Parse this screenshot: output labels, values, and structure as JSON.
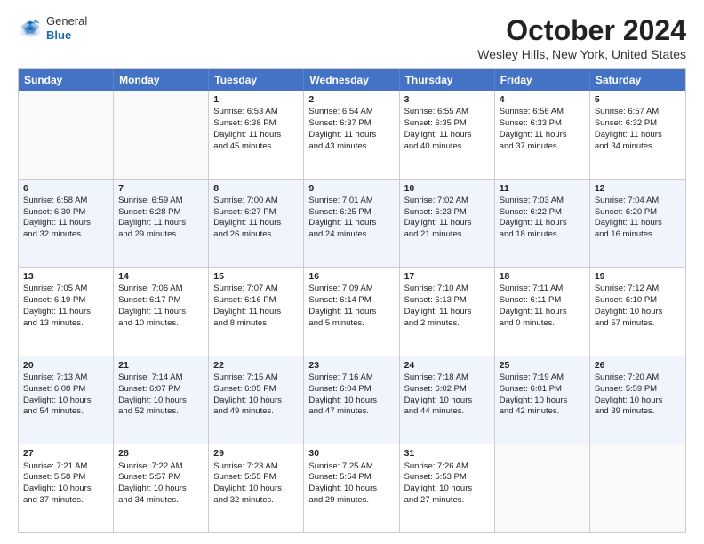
{
  "header": {
    "logo": {
      "general": "General",
      "blue": "Blue"
    },
    "title": "October 2024",
    "location": "Wesley Hills, New York, United States"
  },
  "days_of_week": [
    "Sunday",
    "Monday",
    "Tuesday",
    "Wednesday",
    "Thursday",
    "Friday",
    "Saturday"
  ],
  "weeks": [
    [
      {
        "day": "",
        "lines": [],
        "empty": true
      },
      {
        "day": "",
        "lines": [],
        "empty": true
      },
      {
        "day": "1",
        "lines": [
          "Sunrise: 6:53 AM",
          "Sunset: 6:38 PM",
          "Daylight: 11 hours",
          "and 45 minutes."
        ]
      },
      {
        "day": "2",
        "lines": [
          "Sunrise: 6:54 AM",
          "Sunset: 6:37 PM",
          "Daylight: 11 hours",
          "and 43 minutes."
        ]
      },
      {
        "day": "3",
        "lines": [
          "Sunrise: 6:55 AM",
          "Sunset: 6:35 PM",
          "Daylight: 11 hours",
          "and 40 minutes."
        ]
      },
      {
        "day": "4",
        "lines": [
          "Sunrise: 6:56 AM",
          "Sunset: 6:33 PM",
          "Daylight: 11 hours",
          "and 37 minutes."
        ]
      },
      {
        "day": "5",
        "lines": [
          "Sunrise: 6:57 AM",
          "Sunset: 6:32 PM",
          "Daylight: 11 hours",
          "and 34 minutes."
        ]
      }
    ],
    [
      {
        "day": "6",
        "lines": [
          "Sunrise: 6:58 AM",
          "Sunset: 6:30 PM",
          "Daylight: 11 hours",
          "and 32 minutes."
        ]
      },
      {
        "day": "7",
        "lines": [
          "Sunrise: 6:59 AM",
          "Sunset: 6:28 PM",
          "Daylight: 11 hours",
          "and 29 minutes."
        ]
      },
      {
        "day": "8",
        "lines": [
          "Sunrise: 7:00 AM",
          "Sunset: 6:27 PM",
          "Daylight: 11 hours",
          "and 26 minutes."
        ]
      },
      {
        "day": "9",
        "lines": [
          "Sunrise: 7:01 AM",
          "Sunset: 6:25 PM",
          "Daylight: 11 hours",
          "and 24 minutes."
        ]
      },
      {
        "day": "10",
        "lines": [
          "Sunrise: 7:02 AM",
          "Sunset: 6:23 PM",
          "Daylight: 11 hours",
          "and 21 minutes."
        ]
      },
      {
        "day": "11",
        "lines": [
          "Sunrise: 7:03 AM",
          "Sunset: 6:22 PM",
          "Daylight: 11 hours",
          "and 18 minutes."
        ]
      },
      {
        "day": "12",
        "lines": [
          "Sunrise: 7:04 AM",
          "Sunset: 6:20 PM",
          "Daylight: 11 hours",
          "and 16 minutes."
        ]
      }
    ],
    [
      {
        "day": "13",
        "lines": [
          "Sunrise: 7:05 AM",
          "Sunset: 6:19 PM",
          "Daylight: 11 hours",
          "and 13 minutes."
        ]
      },
      {
        "day": "14",
        "lines": [
          "Sunrise: 7:06 AM",
          "Sunset: 6:17 PM",
          "Daylight: 11 hours",
          "and 10 minutes."
        ]
      },
      {
        "day": "15",
        "lines": [
          "Sunrise: 7:07 AM",
          "Sunset: 6:16 PM",
          "Daylight: 11 hours",
          "and 8 minutes."
        ]
      },
      {
        "day": "16",
        "lines": [
          "Sunrise: 7:09 AM",
          "Sunset: 6:14 PM",
          "Daylight: 11 hours",
          "and 5 minutes."
        ]
      },
      {
        "day": "17",
        "lines": [
          "Sunrise: 7:10 AM",
          "Sunset: 6:13 PM",
          "Daylight: 11 hours",
          "and 2 minutes."
        ]
      },
      {
        "day": "18",
        "lines": [
          "Sunrise: 7:11 AM",
          "Sunset: 6:11 PM",
          "Daylight: 11 hours",
          "and 0 minutes."
        ]
      },
      {
        "day": "19",
        "lines": [
          "Sunrise: 7:12 AM",
          "Sunset: 6:10 PM",
          "Daylight: 10 hours",
          "and 57 minutes."
        ]
      }
    ],
    [
      {
        "day": "20",
        "lines": [
          "Sunrise: 7:13 AM",
          "Sunset: 6:08 PM",
          "Daylight: 10 hours",
          "and 54 minutes."
        ]
      },
      {
        "day": "21",
        "lines": [
          "Sunrise: 7:14 AM",
          "Sunset: 6:07 PM",
          "Daylight: 10 hours",
          "and 52 minutes."
        ]
      },
      {
        "day": "22",
        "lines": [
          "Sunrise: 7:15 AM",
          "Sunset: 6:05 PM",
          "Daylight: 10 hours",
          "and 49 minutes."
        ]
      },
      {
        "day": "23",
        "lines": [
          "Sunrise: 7:16 AM",
          "Sunset: 6:04 PM",
          "Daylight: 10 hours",
          "and 47 minutes."
        ]
      },
      {
        "day": "24",
        "lines": [
          "Sunrise: 7:18 AM",
          "Sunset: 6:02 PM",
          "Daylight: 10 hours",
          "and 44 minutes."
        ]
      },
      {
        "day": "25",
        "lines": [
          "Sunrise: 7:19 AM",
          "Sunset: 6:01 PM",
          "Daylight: 10 hours",
          "and 42 minutes."
        ]
      },
      {
        "day": "26",
        "lines": [
          "Sunrise: 7:20 AM",
          "Sunset: 5:59 PM",
          "Daylight: 10 hours",
          "and 39 minutes."
        ]
      }
    ],
    [
      {
        "day": "27",
        "lines": [
          "Sunrise: 7:21 AM",
          "Sunset: 5:58 PM",
          "Daylight: 10 hours",
          "and 37 minutes."
        ]
      },
      {
        "day": "28",
        "lines": [
          "Sunrise: 7:22 AM",
          "Sunset: 5:57 PM",
          "Daylight: 10 hours",
          "and 34 minutes."
        ]
      },
      {
        "day": "29",
        "lines": [
          "Sunrise: 7:23 AM",
          "Sunset: 5:55 PM",
          "Daylight: 10 hours",
          "and 32 minutes."
        ]
      },
      {
        "day": "30",
        "lines": [
          "Sunrise: 7:25 AM",
          "Sunset: 5:54 PM",
          "Daylight: 10 hours",
          "and 29 minutes."
        ]
      },
      {
        "day": "31",
        "lines": [
          "Sunrise: 7:26 AM",
          "Sunset: 5:53 PM",
          "Daylight: 10 hours",
          "and 27 minutes."
        ]
      },
      {
        "day": "",
        "lines": [],
        "empty": true
      },
      {
        "day": "",
        "lines": [],
        "empty": true
      }
    ]
  ]
}
